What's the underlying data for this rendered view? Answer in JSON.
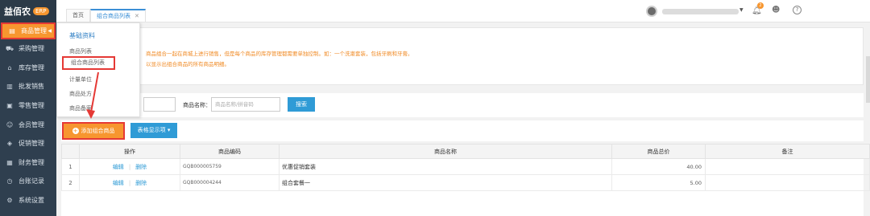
{
  "brand": {
    "name": "益佰农",
    "badge": "ERP"
  },
  "sidebar": {
    "items": [
      {
        "label": "商品管理",
        "icon": "goods-icon"
      },
      {
        "label": "采购管理",
        "icon": "cart-icon"
      },
      {
        "label": "库存管理",
        "icon": "warehouse-icon"
      },
      {
        "label": "批发销售",
        "icon": "chart-icon"
      },
      {
        "label": "零售管理",
        "icon": "store-icon"
      },
      {
        "label": "会员管理",
        "icon": "member-icon"
      },
      {
        "label": "促销管理",
        "icon": "tag-icon"
      },
      {
        "label": "财务管理",
        "icon": "wallet-icon"
      },
      {
        "label": "台账记录",
        "icon": "clock-icon"
      },
      {
        "label": "系统设置",
        "icon": "gear-icon"
      }
    ]
  },
  "tabs": {
    "home": "首页",
    "current": "组合商品列表"
  },
  "topbar": {
    "notification_count": "2"
  },
  "dropdown": {
    "title": "基础资料",
    "items": [
      "商品列表",
      "组合商品列表",
      "计量单位",
      "商品处方",
      "商品备案"
    ]
  },
  "notice": {
    "line1": "商品组合一起在商城上进行销售，但是每个商品的库存管理都需要单独控制。如：一个洗漱套装，包括牙刷和牙膏。",
    "line2": "以显示出组合商品的所有商品明细。"
  },
  "search": {
    "label": "商品名称：",
    "placeholder": "商品名称/拼音码",
    "button": "搜索"
  },
  "actions": {
    "add": "添加组合商品",
    "columns": "表格显示项 ▾"
  },
  "table": {
    "headers": [
      "操作",
      "商品编码",
      "商品名称",
      "商品总价",
      "备注"
    ],
    "edit": "编辑",
    "delete": "删除",
    "rows": [
      {
        "index": "1",
        "code": "GQB000005759",
        "name": "优惠促销套装",
        "total": "40.00",
        "note": ""
      },
      {
        "index": "2",
        "code": "GQB000004244",
        "name": "组合套餐一",
        "total": "5.00",
        "note": ""
      }
    ]
  },
  "colors": {
    "accent": "#f7962f",
    "primary": "#2f9bd6",
    "sidebar": "#2f3f4f",
    "highlight": "#e53935"
  }
}
